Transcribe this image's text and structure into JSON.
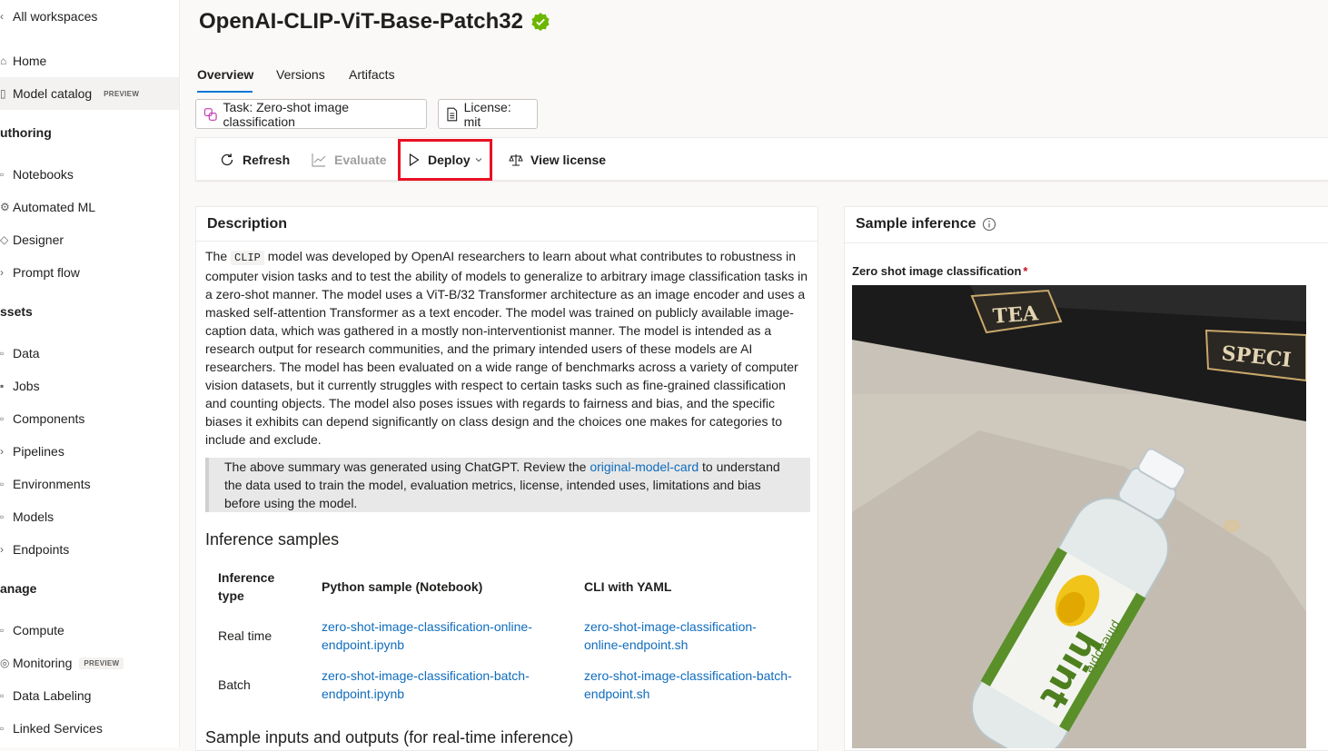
{
  "sidebar": {
    "all_workspaces": "All workspaces",
    "home": "Home",
    "model_catalog": "Model catalog",
    "preview_badge": "PREVIEW",
    "sections": {
      "authoring": "uthoring",
      "assets": "ssets",
      "manage": "anage"
    },
    "authoring_items": [
      "Notebooks",
      "Automated ML",
      "Designer",
      "Prompt flow"
    ],
    "assets_items": [
      "Data",
      "Jobs",
      "Components",
      "Pipelines",
      "Environments",
      "Models",
      "Endpoints"
    ],
    "manage_items": [
      "Compute",
      "Monitoring",
      "Data Labeling",
      "Linked Services"
    ]
  },
  "page": {
    "title": "OpenAI-CLIP-ViT-Base-Patch32",
    "tabs": [
      "Overview",
      "Versions",
      "Artifacts"
    ],
    "task_pill": "Task: Zero-shot image classification",
    "license_pill": "License: mit"
  },
  "toolbar": {
    "refresh": "Refresh",
    "evaluate": "Evaluate",
    "deploy": "Deploy",
    "view_license": "View license"
  },
  "description": {
    "title": "Description",
    "para_pre": "The ",
    "para_code": "CLIP",
    "para_post": " model was developed by OpenAI researchers to learn about what contributes to robustness in computer vision tasks and to test the ability of models to generalize to arbitrary image classification tasks in a zero-shot manner. The model uses a ViT-B/32 Transformer architecture as an image encoder and uses a masked self-attention Transformer as a text encoder. The model was trained on publicly available image-caption data, which was gathered in a mostly non-interventionist manner. The model is intended as a research output for research communities, and the primary intended users of these models are AI researchers. The model has been evaluated on a wide range of benchmarks across a variety of computer vision datasets, but it currently struggles with respect to certain tasks such as fine-grained classification and counting objects. The model also poses issues with regards to fairness and bias, and the specific biases it exhibits can depend significantly on class design and the choices one makes for categories to include and exclude.",
    "quote_pre": "The above summary was generated using ChatGPT. Review the ",
    "quote_link": "original-model-card",
    "quote_post": " to understand the data used to train the model, evaluation metrics, license, intended uses, limitations and bias before using the model.",
    "inference_heading": "Inference samples",
    "table": {
      "headers": [
        "Inference type",
        "Python sample (Notebook)",
        "CLI with YAML"
      ],
      "rows": [
        {
          "type": "Real time",
          "python": "zero-shot-image-classification-online-endpoint.ipynb",
          "cli": "zero-shot-image-classification-online-endpoint.sh"
        },
        {
          "type": "Batch",
          "python": "zero-shot-image-classification-batch-endpoint.ipynb",
          "cli": "zero-shot-image-classification-batch-endpoint.sh"
        }
      ]
    },
    "sample_io_heading": "Sample inputs and outputs (for real-time inference)"
  },
  "sample_inference": {
    "title": "Sample inference",
    "field_label": "Zero shot image classification",
    "required_mark": "*",
    "image_texts": {
      "tea": "TEA",
      "spec": "SPECI",
      "bottle_brand": "hint",
      "bottle_flavor": "pineapple"
    }
  },
  "colors": {
    "accent": "#0078d4",
    "link": "#0f6cbd",
    "highlight": "#e81123",
    "verified": "#6bb700"
  }
}
